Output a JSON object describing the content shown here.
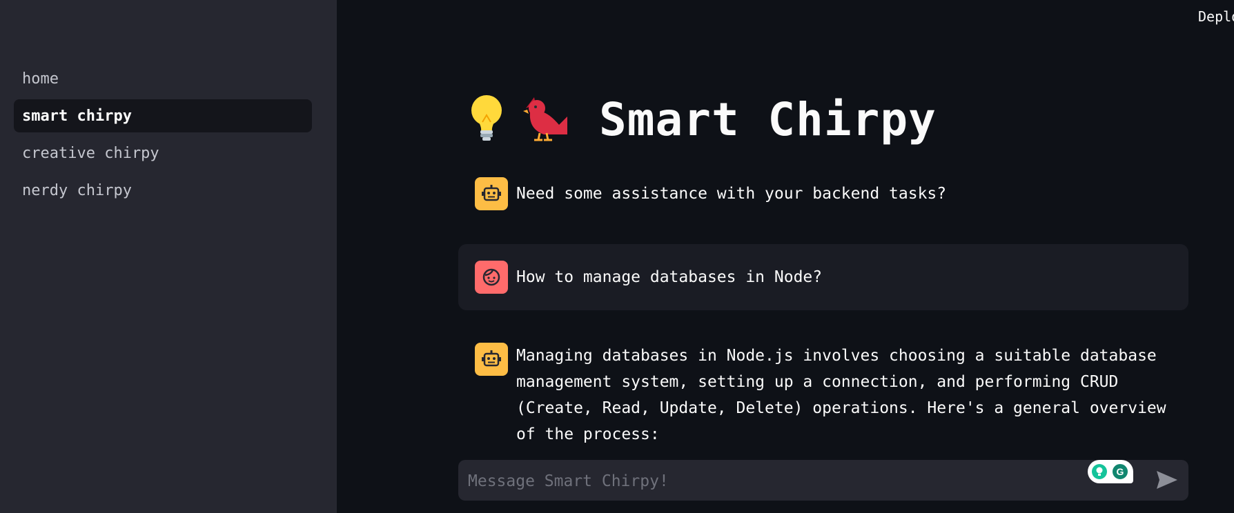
{
  "app": {
    "deploy_label": "Deploy"
  },
  "sidebar": {
    "items": [
      {
        "label": "home",
        "active": false
      },
      {
        "label": "smart chirpy",
        "active": true
      },
      {
        "label": "creative chirpy",
        "active": false
      },
      {
        "label": "nerdy chirpy",
        "active": false
      }
    ]
  },
  "header": {
    "title": "Smart Chirpy",
    "icons": [
      "lightbulb-icon",
      "cardinal-bird-icon"
    ]
  },
  "chat": {
    "messages": [
      {
        "role": "assistant",
        "avatar_icon": "robot-icon",
        "text": "Need some assistance with your backend tasks?"
      },
      {
        "role": "user",
        "avatar_icon": "face-icon",
        "text": "How to manage databases in Node?"
      },
      {
        "role": "assistant",
        "avatar_icon": "robot-icon",
        "text": "Managing databases in Node.js involves choosing a suitable database management system, setting up a connection, and performing CRUD (Create, Read, Update, Delete) operations. Here's a general overview of the process:"
      }
    ]
  },
  "input": {
    "placeholder": "Message Smart Chirpy!",
    "value": ""
  },
  "colors": {
    "background": "#0e1117",
    "sidebar": "#262730",
    "bot_avatar": "#fdbd45",
    "user_avatar": "#ff6b6b",
    "grammarly": "#15c39a"
  }
}
